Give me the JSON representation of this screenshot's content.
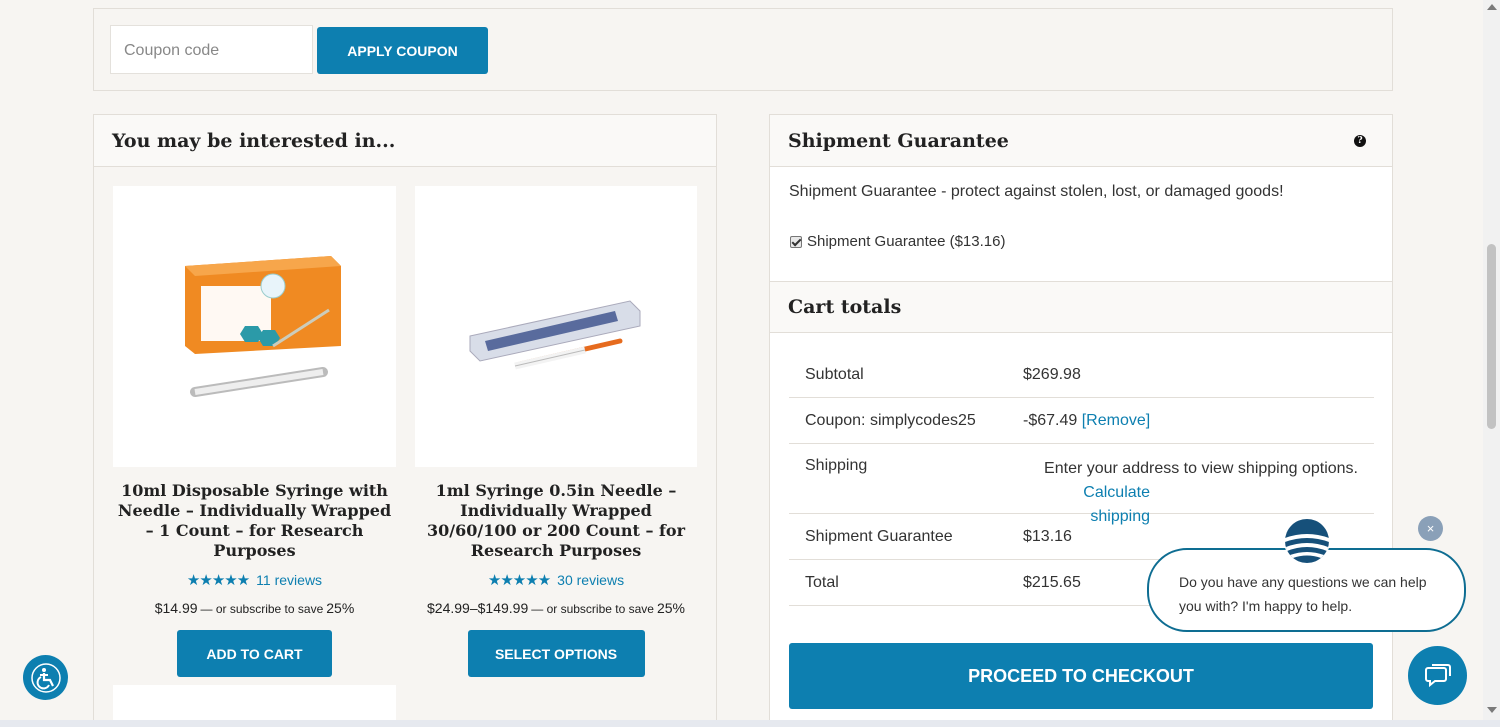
{
  "coupon": {
    "placeholder": "Coupon code",
    "apply_label": "APPLY COUPON"
  },
  "interested": {
    "title": "You may be interested in...",
    "products": [
      {
        "name": "10ml Disposable Syringe with Needle – Individually Wrapped – 1 Count – for Research Purposes",
        "stars": "★★★★★",
        "reviews": "11 reviews",
        "price": "$14.99",
        "subscribe": "— or subscribe to save",
        "save": "25%",
        "button": "ADD TO CART"
      },
      {
        "name": "1ml Syringe 0.5in Needle – Individually Wrapped 30/60/100 or 200 Count – for Research Purposes",
        "stars": "★★★★★",
        "reviews": "30 reviews",
        "price": "$24.99–$149.99",
        "subscribe": "— or subscribe to save",
        "save": "25%",
        "button": "SELECT OPTIONS"
      }
    ]
  },
  "shipment": {
    "title": "Shipment Guarantee",
    "help_icon": "?",
    "description": "Shipment Guarantee - protect against stolen, lost, or damaged goods!",
    "checkbox_label": "Shipment Guarantee ($13.16)",
    "checked": true
  },
  "cart_totals": {
    "title": "Cart totals",
    "subtotal_label": "Subtotal",
    "subtotal_value": "$269.98",
    "coupon_label": "Coupon: simplycodes25",
    "coupon_value": "-$67.49",
    "coupon_remove": "[Remove]",
    "shipping_label": "Shipping",
    "shipping_note": "Enter your address to view shipping options.",
    "shipping_link": "Calculate shipping",
    "guarantee_label": "Shipment Guarantee",
    "guarantee_value": "$13.16",
    "total_label": "Total",
    "total_value": "$215.65",
    "checkout_label": "PROCEED TO CHECKOUT"
  },
  "chat": {
    "message": "Do you have any questions we can help you with? I'm happy to help.",
    "close_glyph": "×"
  },
  "colors": {
    "accent": "#0d7fb0",
    "background": "#f7f5f2",
    "chat_border": "#0e6d92"
  },
  "icons": [
    "help-icon",
    "checkbox-checked-icon",
    "close-icon",
    "chat-icon",
    "accessibility-icon"
  ]
}
